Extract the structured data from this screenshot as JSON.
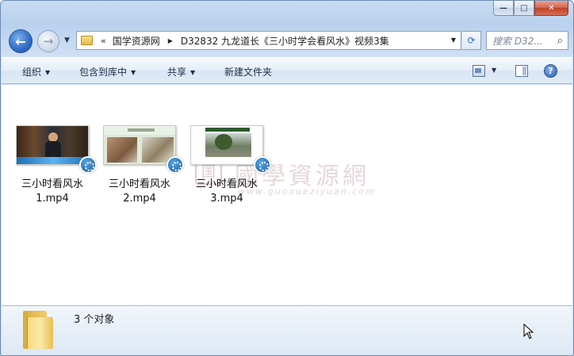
{
  "window": {
    "caption_buttons": {
      "minimize": "—",
      "maximize": "□",
      "close": "✕"
    }
  },
  "nav": {
    "back_icon": "←",
    "forward_icon": "→",
    "history_caret": "▼",
    "address": {
      "overflow": "«",
      "crumbs": [
        "国学资源网",
        "D32832 九龙道长《三小时学会看风水》视频3集"
      ],
      "separator": "▶",
      "dropdown": "▼"
    },
    "refresh_icon": "⟳",
    "search_placeholder": "搜索 D32...",
    "search_icon": "⌕"
  },
  "toolbar": {
    "organize": "组织",
    "include_in_library": "包含到库中",
    "share": "共享",
    "new_folder": "新建文件夹",
    "caret": "▼",
    "help": "?"
  },
  "files": [
    {
      "line1": "三小时看风水",
      "line2": "1.mp4"
    },
    {
      "line1": "三小时看风水",
      "line2": "2.mp4"
    },
    {
      "line1": "三小时看风水",
      "line2": "3.mp4"
    }
  ],
  "watermark": {
    "seal": "国",
    "text": "國學資源網",
    "url": "www.guoxueziyuan.com"
  },
  "details": {
    "status": "3 个对象"
  },
  "colors": {
    "window_frame": "#b9d1ee",
    "toolbar": "#e1ebf7",
    "badge": "#11569e",
    "close_button": "#c14128"
  }
}
